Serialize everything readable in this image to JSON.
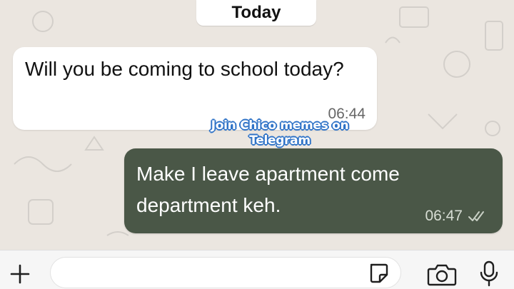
{
  "chat": {
    "date_divider": "Today",
    "messages": [
      {
        "direction": "incoming",
        "text": "Will you be coming to school today?",
        "time": "06:44"
      },
      {
        "direction": "outgoing",
        "text": "Make I leave apartment come department keh.",
        "time": "06:47",
        "status_icon": "double-check-icon"
      }
    ]
  },
  "overlay": {
    "watermark_line1": "Join Chico memes on",
    "watermark_line2": "Telegram"
  },
  "composer": {
    "placeholder": "",
    "icons": [
      "plus-icon",
      "sticker-icon",
      "camera-icon",
      "microphone-icon"
    ]
  },
  "colors": {
    "wallpaper": "#ebe6e0",
    "incoming_bubble": "#ffffff",
    "outgoing_bubble": "#4a5747",
    "watermark_outline": "#2f73c7"
  }
}
